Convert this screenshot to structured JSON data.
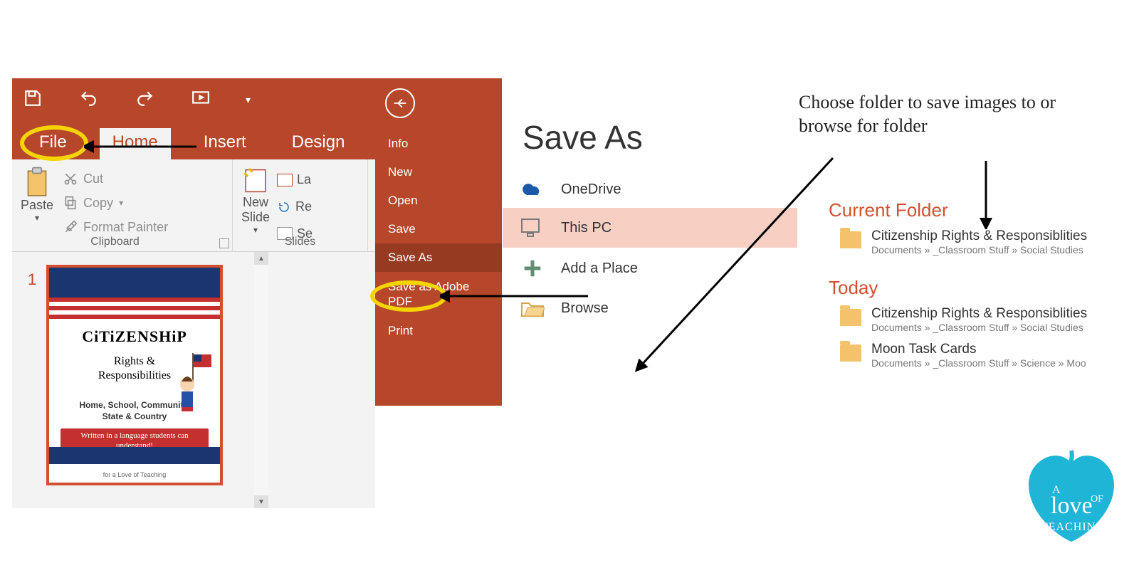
{
  "qat": {
    "save": "save-icon",
    "undo": "undo-icon",
    "redo": "redo-icon",
    "slideshow": "slideshow-icon",
    "more": "more-icon"
  },
  "tabs": {
    "file": "File",
    "home": "Home",
    "insert": "Insert",
    "design": "Design"
  },
  "ribbon": {
    "paste": "Paste",
    "cut": "Cut",
    "copy": "Copy",
    "formatPainter": "Format Painter",
    "clipboard": "Clipboard",
    "newSlide": "New\nSlide",
    "slides": "Slides",
    "l_label": "La",
    "r_label": "Re",
    "s_label": "Se"
  },
  "slideNumber": "1",
  "thumb": {
    "title": "CiTiZENSHiP",
    "sub": "Rights &\nResponsibilities",
    "sub2": "Home, School, Community,\nState & Country",
    "redbox": "Written in a language students can understand!",
    "foot": "for a Love of Teaching"
  },
  "backstage": {
    "items": [
      "Info",
      "New",
      "Open",
      "Save",
      "Save As",
      "Save as Adobe PDF",
      "Print"
    ],
    "selected": 4
  },
  "saveas": {
    "title": "Save As",
    "locations": [
      {
        "id": "onedrive",
        "label": "OneDrive"
      },
      {
        "id": "thispc",
        "label": "This PC"
      },
      {
        "id": "addplace",
        "label": "Add a Place"
      },
      {
        "id": "browse",
        "label": "Browse"
      }
    ],
    "selected": "thispc"
  },
  "folders": {
    "currentHead": "Current Folder",
    "todayHead": "Today",
    "current": [
      {
        "name": "Citizenship Rights & Responsiblities",
        "path": "Documents » _Classroom Stuff » Social Studies"
      }
    ],
    "today": [
      {
        "name": "Citizenship Rights & Responsiblities",
        "path": "Documents » _Classroom Stuff » Social Studies"
      },
      {
        "name": "Moon Task Cards",
        "path": "Documents » _Classroom Stuff » Science » Moo"
      }
    ]
  },
  "annotation": "Choose folder to save images to or browse for folder",
  "logo": {
    "line1": "A",
    "line2": "love",
    "line3": "OF",
    "line4": "TEACHING"
  }
}
